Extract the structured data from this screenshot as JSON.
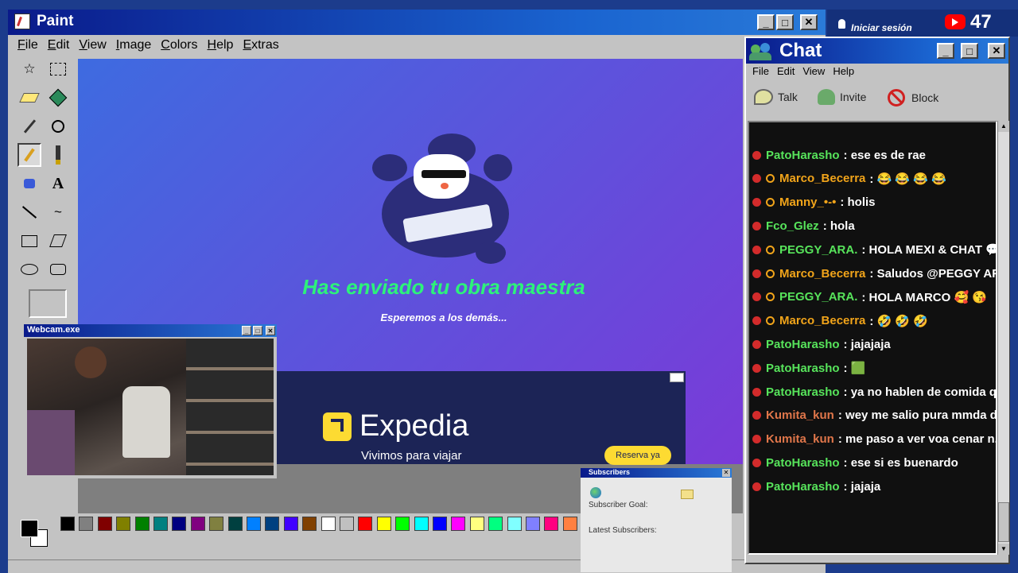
{
  "paint": {
    "title": "Paint",
    "menu": [
      "File",
      "Edit",
      "View",
      "Image",
      "Colors",
      "Help",
      "Extras"
    ],
    "canvas": {
      "heading": "Has enviado tu obra maestra",
      "subheading": "Esperemos a los demás...",
      "ad": {
        "brand": "Expedia",
        "tagline": "Vivimos para viajar",
        "cta": "Reserva ya"
      }
    },
    "palette": [
      "#000000",
      "#808080",
      "#800000",
      "#808000",
      "#008000",
      "#008080",
      "#000080",
      "#800080",
      "#808040",
      "#004040",
      "#0080ff",
      "#004080",
      "#4000ff",
      "#804000",
      "#ffffff",
      "#c0c0c0",
      "#ff0000",
      "#ffff00",
      "#00ff00",
      "#00ffff",
      "#0000ff",
      "#ff00ff",
      "#ffff80",
      "#00ff80",
      "#80ffff",
      "#8080ff",
      "#ff0080",
      "#ff8040"
    ]
  },
  "webcam": {
    "title": "Webcam.exe"
  },
  "youtube": {
    "login": "Iniciar sesión",
    "viewers": "47"
  },
  "chat": {
    "title": "Chat",
    "menu": [
      "File",
      "Edit",
      "View",
      "Help"
    ],
    "toolbar": {
      "talk": "Talk",
      "invite": "Invite",
      "block": "Block"
    },
    "messages": [
      {
        "user": "PatoHarasho",
        "text": ": ese es de rae",
        "color": "#57e45b",
        "mod": false
      },
      {
        "user": "Marco_Becerra",
        "text": ": 😂 😂 😂 😂",
        "color": "#f1a41a",
        "mod": true
      },
      {
        "user": "Manny_•-•",
        "text": ": holis",
        "color": "#f1a41a",
        "mod": true
      },
      {
        "user": "Fco_Glez",
        "text": ": hola",
        "color": "#57e45b",
        "mod": false
      },
      {
        "user": "PEGGY_ARA.",
        "text": ": HOLA MEXI & CHAT 💬 SA",
        "color": "#57e45b",
        "mod": true
      },
      {
        "user": "Marco_Becerra",
        "text": ": Saludos @PEGGY ARA.",
        "color": "#f1a41a",
        "mod": true
      },
      {
        "user": "PEGGY_ARA.",
        "text": ": HOLA MARCO 🥰 😘",
        "color": "#57e45b",
        "mod": true
      },
      {
        "user": "Marco_Becerra",
        "text": ": 🤣 🤣 🤣",
        "color": "#f1a41a",
        "mod": true
      },
      {
        "user": "PatoHarasho",
        "text": ": jajajaja",
        "color": "#57e45b",
        "mod": false
      },
      {
        "user": "PatoHarasho",
        "text": ": 🟩",
        "color": "#57e45b",
        "mod": false
      },
      {
        "user": "PatoHarasho",
        "text": ": ya no hablen de comida que m",
        "color": "#57e45b",
        "mod": false
      },
      {
        "user": "Kumita_kun",
        "text": ": wey me salio pura mmda de in",
        "color": "#e0764a",
        "mod": false
      },
      {
        "user": "Kumita_kun",
        "text": ": me paso a ver voa cenar n.n",
        "color": "#e0764a",
        "mod": false
      },
      {
        "user": "PatoHarasho",
        "text": ": ese si es buenardo",
        "color": "#57e45b",
        "mod": false
      },
      {
        "user": "PatoHarasho",
        "text": ": jajaja",
        "color": "#57e45b",
        "mod": false
      }
    ]
  },
  "subscribers": {
    "title": "Subscribers",
    "goal_label": "Subscriber Goal:",
    "latest_label": "Latest Subscribers:"
  },
  "icons": {
    "tools": [
      "free-select-icon",
      "rect-select-icon",
      "eraser-icon",
      "fill-icon",
      "color-picker-icon",
      "magnifier-icon",
      "pencil-icon",
      "brush-icon",
      "airbrush-icon",
      "text-icon",
      "line-icon",
      "curve-icon",
      "rectangle-icon",
      "polygon-icon",
      "ellipse-icon",
      "rounded-rect-icon"
    ]
  }
}
